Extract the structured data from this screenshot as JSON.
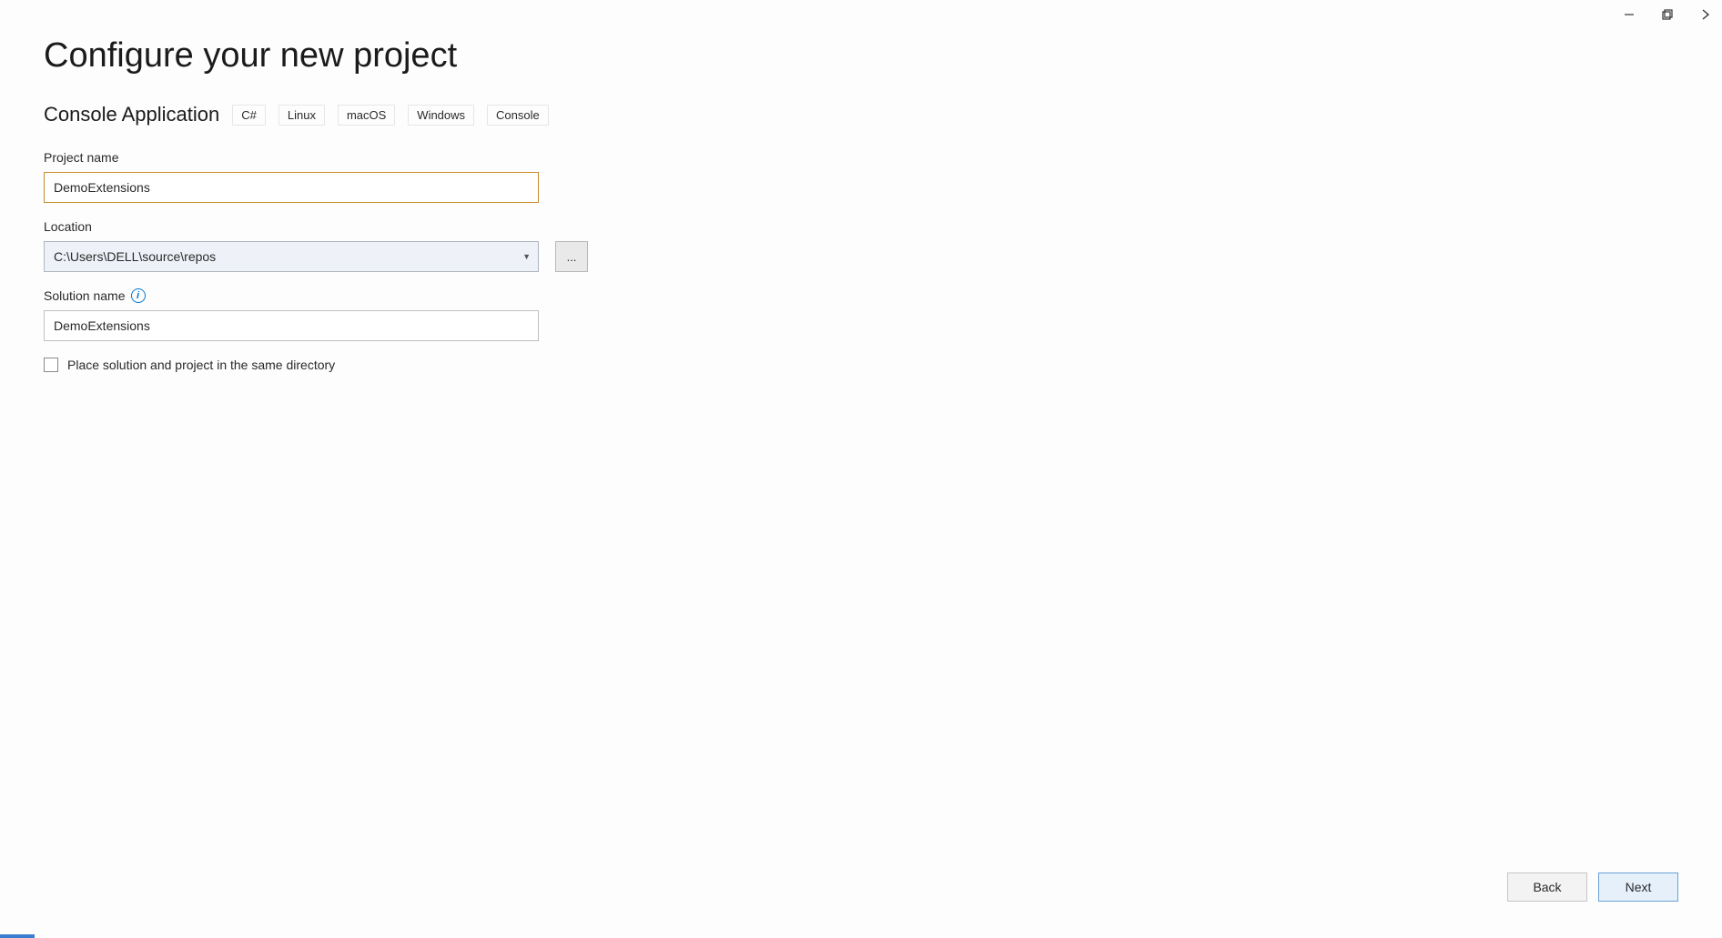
{
  "window": {
    "title": "Configure your new project"
  },
  "template": {
    "name": "Console Application",
    "tags": [
      "C#",
      "Linux",
      "macOS",
      "Windows",
      "Console"
    ]
  },
  "fields": {
    "projectName": {
      "label": "Project name",
      "value": "DemoExtensions"
    },
    "location": {
      "label": "Location",
      "value": "C:\\Users\\DELL\\source\\repos",
      "browseLabel": "..."
    },
    "solutionName": {
      "label": "Solution name",
      "value": "DemoExtensions"
    },
    "sameDirectory": {
      "label": "Place solution and project in the same directory",
      "checked": false
    }
  },
  "buttons": {
    "back": "Back",
    "next": "Next"
  }
}
